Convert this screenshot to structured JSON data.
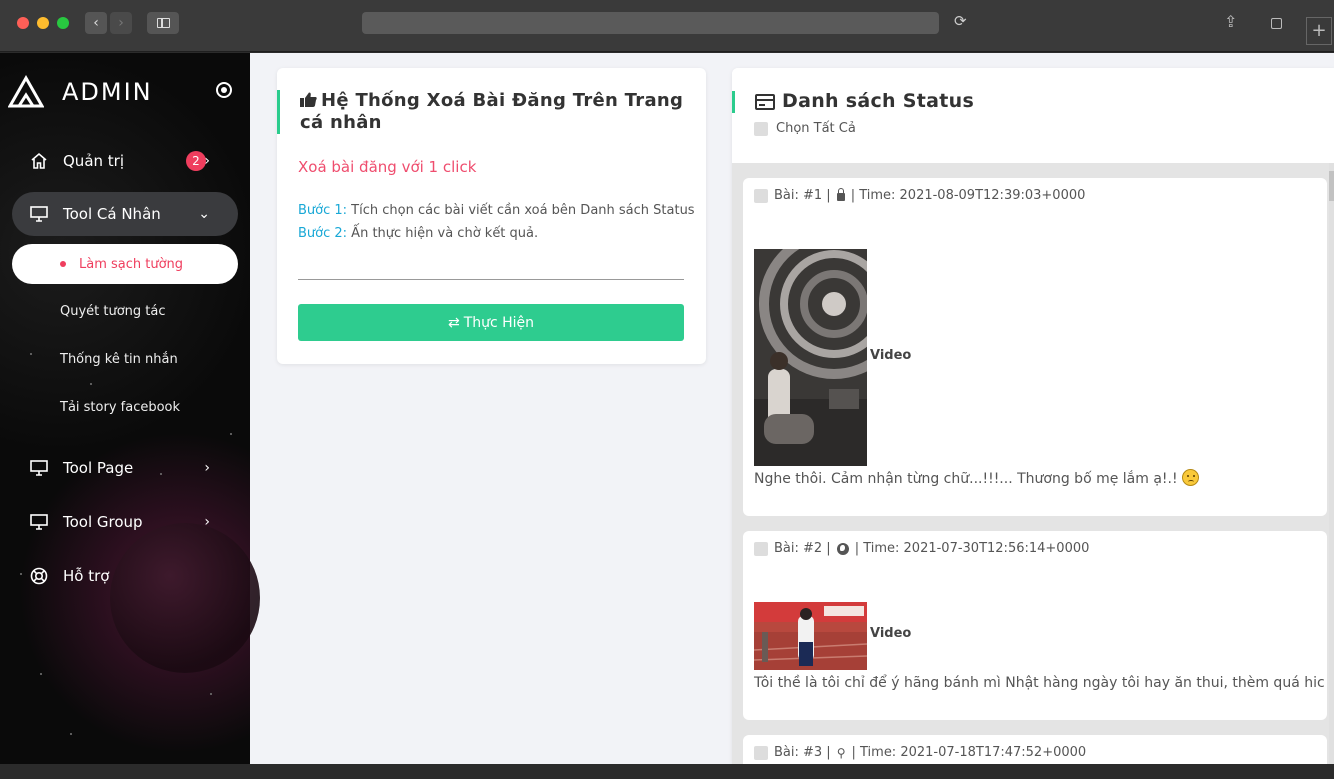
{
  "sidebar": {
    "brand": "ADMIN",
    "items": [
      {
        "label": "Quản trị",
        "badge": "2",
        "icon": "home-icon"
      },
      {
        "label": "Tool Cá Nhân",
        "icon": "monitor-icon"
      },
      {
        "label": "Tool Page",
        "icon": "monitor-icon"
      },
      {
        "label": "Tool Group",
        "icon": "monitor-icon"
      },
      {
        "label": "Hỗ trợ",
        "icon": "lifebuoy-icon"
      }
    ],
    "sub_items": [
      {
        "label": "Làm sạch tường",
        "active": true
      },
      {
        "label": "Quyét tương tác"
      },
      {
        "label": "Thống kê tin nhắn"
      },
      {
        "label": "Tải story facebook"
      }
    ]
  },
  "panel": {
    "title": "Hệ Thống Xoá Bài Đăng Trên Trang cá nhân",
    "subtitle": "Xoá bài đăng với 1 click",
    "step1_key": "Bước 1:",
    "step1_text": " Tích chọn các bài viết cần xoá bên Danh sách Status",
    "step2_key": "Bước 2:",
    "step2_text": " Ấn thực hiện và chờ kết quả.",
    "run_button": "Thực Hiện"
  },
  "status": {
    "title": "Danh sách Status",
    "select_all": "Chọn Tất Cả",
    "posts": [
      {
        "meta_prefix": "Bài: #1 |",
        "meta_suffix": "| Time: 2021-08-09T12:39:03+0000",
        "privacy_icon": "lock-icon",
        "media_label": "Video",
        "text": "Nghe thôi. Cảm nhận từng chữ...!!!... Thương bố mẹ lắm ạ!.!"
      },
      {
        "meta_prefix": "Bài: #2 |",
        "meta_suffix": "| Time: 2021-07-30T12:56:14+0000",
        "privacy_icon": "globe-icon",
        "media_label": "Video",
        "text": "Tôi thề là tôi chỉ để ý hãng bánh mì Nhật hàng ngày tôi hay ăn thui, thèm quá hic hic"
      },
      {
        "meta_prefix": "Bài: #3 |",
        "meta_suffix": "| Time: 2021-07-18T17:47:52+0000",
        "privacy_icon": "pin-icon"
      }
    ]
  },
  "colors": {
    "accent_green": "#2ecc8f",
    "accent_red": "#ef3e5e",
    "link_blue": "#19a8d6"
  }
}
